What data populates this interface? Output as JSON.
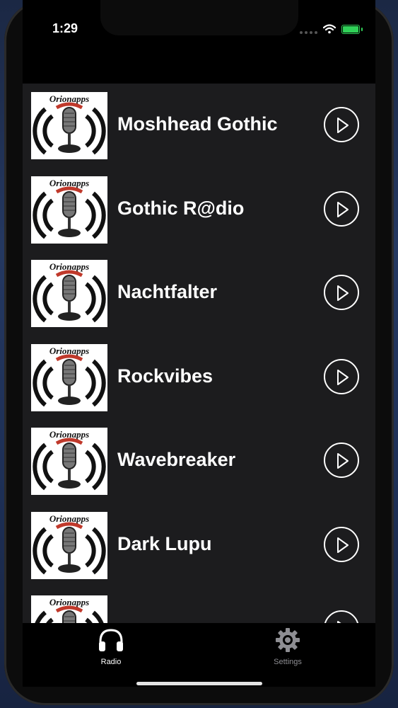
{
  "status_bar": {
    "time": "1:29"
  },
  "stations": [
    {
      "brand": "Orionapps",
      "name": "Moshhead Gothic"
    },
    {
      "brand": "Orionapps",
      "name": "Gothic R@dio"
    },
    {
      "brand": "Orionapps",
      "name": "Nachtfalter"
    },
    {
      "brand": "Orionapps",
      "name": "Rockvibes"
    },
    {
      "brand": "Orionapps",
      "name": "Wavebreaker"
    },
    {
      "brand": "Orionapps",
      "name": "Dark Lupu"
    },
    {
      "brand": "Orionapps",
      "name": ""
    }
  ],
  "tabbar": {
    "tabs": [
      {
        "label": "Radio",
        "icon": "headphones-icon",
        "active": true
      },
      {
        "label": "Settings",
        "icon": "gear-icon",
        "active": false
      }
    ]
  },
  "colors": {
    "list_bg": "#1c1c1e",
    "active_tab": "#ffffff",
    "inactive_tab": "#8e8e93",
    "battery": "#30d158"
  }
}
